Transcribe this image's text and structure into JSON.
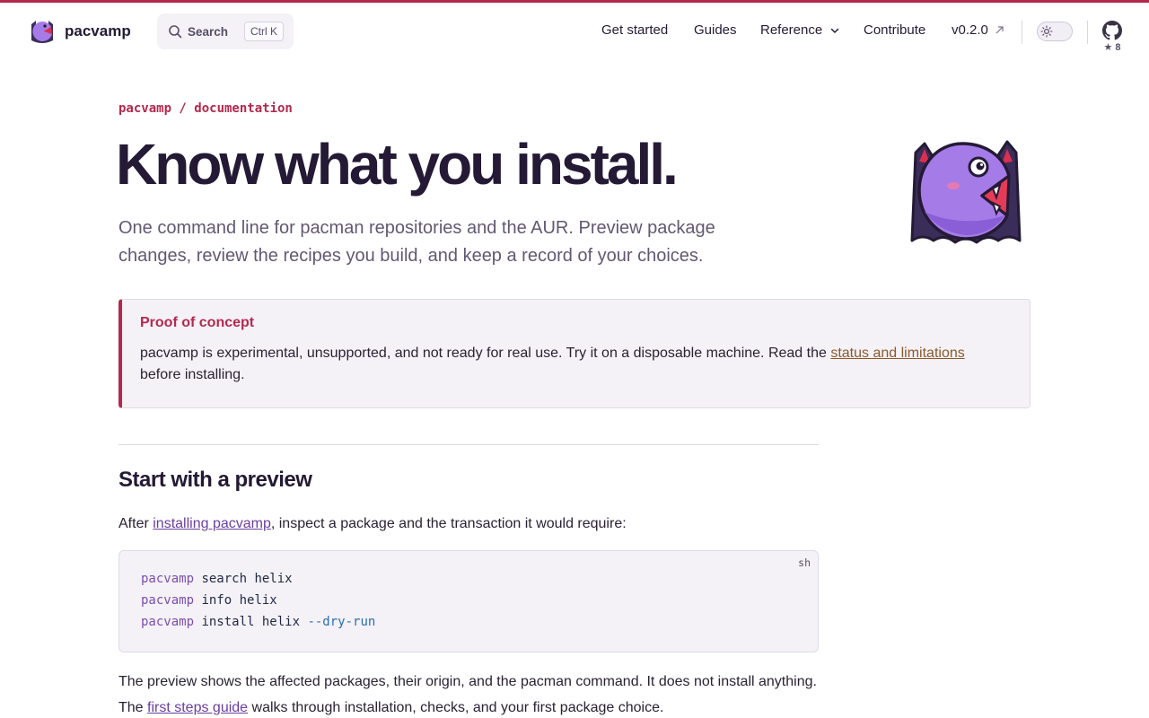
{
  "header": {
    "brand": "pacvamp",
    "search_label": "Search",
    "search_shortcut": "Ctrl K",
    "nav": {
      "get_started": "Get started",
      "guides": "Guides",
      "reference": "Reference",
      "contribute": "Contribute",
      "version": "v0.2.0"
    },
    "github_stars": "★ 8"
  },
  "hero": {
    "breadcrumb": "pacvamp / documentation",
    "title": "Know what you install.",
    "lead": "One command line for pacman repositories and the AUR. Preview package changes, review the recipes you build, and keep a record of your choices."
  },
  "callout": {
    "title": "Proof of concept",
    "body_before": "pacvamp is experimental, unsupported, and not ready for real use. Try it on a disposable machine. Read the ",
    "link": "status and limitations",
    "body_after": " before installing."
  },
  "section": {
    "title": "Start with a preview",
    "intro_before": "After ",
    "intro_link": "installing pacvamp",
    "intro_after": ", inspect a package and the transaction it would require:",
    "code_lang": "sh",
    "code_lines": [
      {
        "cmd": "pacvamp",
        "args": " search helix",
        "flag": ""
      },
      {
        "cmd": "pacvamp",
        "args": " info helix",
        "flag": ""
      },
      {
        "cmd": "pacvamp",
        "args": " install helix ",
        "flag": "--dry-run"
      }
    ],
    "outro_before": "The preview shows the affected packages, their origin, and the pacman command. It does not install anything. The ",
    "outro_link": "first steps guide",
    "outro_after": " walks through installation, checks, and your first package choice."
  },
  "colors": {
    "accent": "#b3294e",
    "ink": "#241a35",
    "link": "#6b3fa0",
    "mascot_body": "#a57be8"
  }
}
